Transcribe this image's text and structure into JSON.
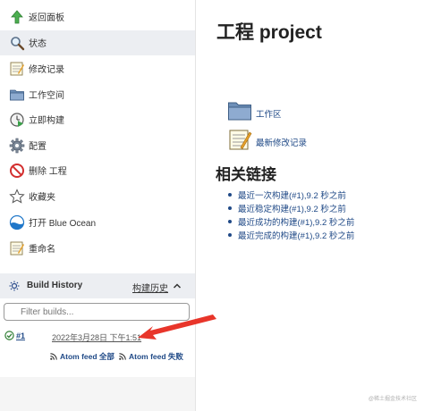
{
  "sidebar": {
    "items": [
      {
        "label": "返回面板",
        "icon": "up-arrow-icon"
      },
      {
        "label": "状态",
        "icon": "search-icon"
      },
      {
        "label": "修改记录",
        "icon": "notepad-icon"
      },
      {
        "label": "工作空间",
        "icon": "folder-icon"
      },
      {
        "label": "立即构建",
        "icon": "clock-play-icon"
      },
      {
        "label": "配置",
        "icon": "gear-icon"
      },
      {
        "label": "删除 工程",
        "icon": "no-entry-icon"
      },
      {
        "label": "收藏夹",
        "icon": "star-icon"
      },
      {
        "label": "打开 Blue Ocean",
        "icon": "blue-ocean-icon"
      },
      {
        "label": "重命名",
        "icon": "notepad-icon"
      }
    ],
    "active_index": 1
  },
  "build_history": {
    "title": "Build History",
    "trend_label": "构建历史",
    "filter_placeholder": "Filter builds...",
    "builds": [
      {
        "number": "#1",
        "date": "2022年3月28日 下午1:51",
        "status": "success"
      }
    ],
    "feeds": {
      "all": "Atom feed 全部",
      "failed": "Atom feed 失败"
    }
  },
  "main": {
    "title": "工程 project",
    "links": [
      {
        "label": "工作区",
        "icon": "folder-icon"
      },
      {
        "label": "最新修改记录",
        "icon": "notepad-icon"
      }
    ],
    "related_title": "相关链接",
    "related_links": [
      "最近一次构建(#1),9.2 秒之前",
      "最近稳定构建(#1),9.2 秒之前",
      "最近成功的构建(#1),9.2 秒之前",
      "最近完成的构建(#1),9.2 秒之前"
    ]
  },
  "watermark": "@稀土掘金技术社区",
  "colors": {
    "link": "#204a87",
    "active_bg": "#eceef2",
    "success": "#2e7d32",
    "arrow": "#e8352a"
  }
}
